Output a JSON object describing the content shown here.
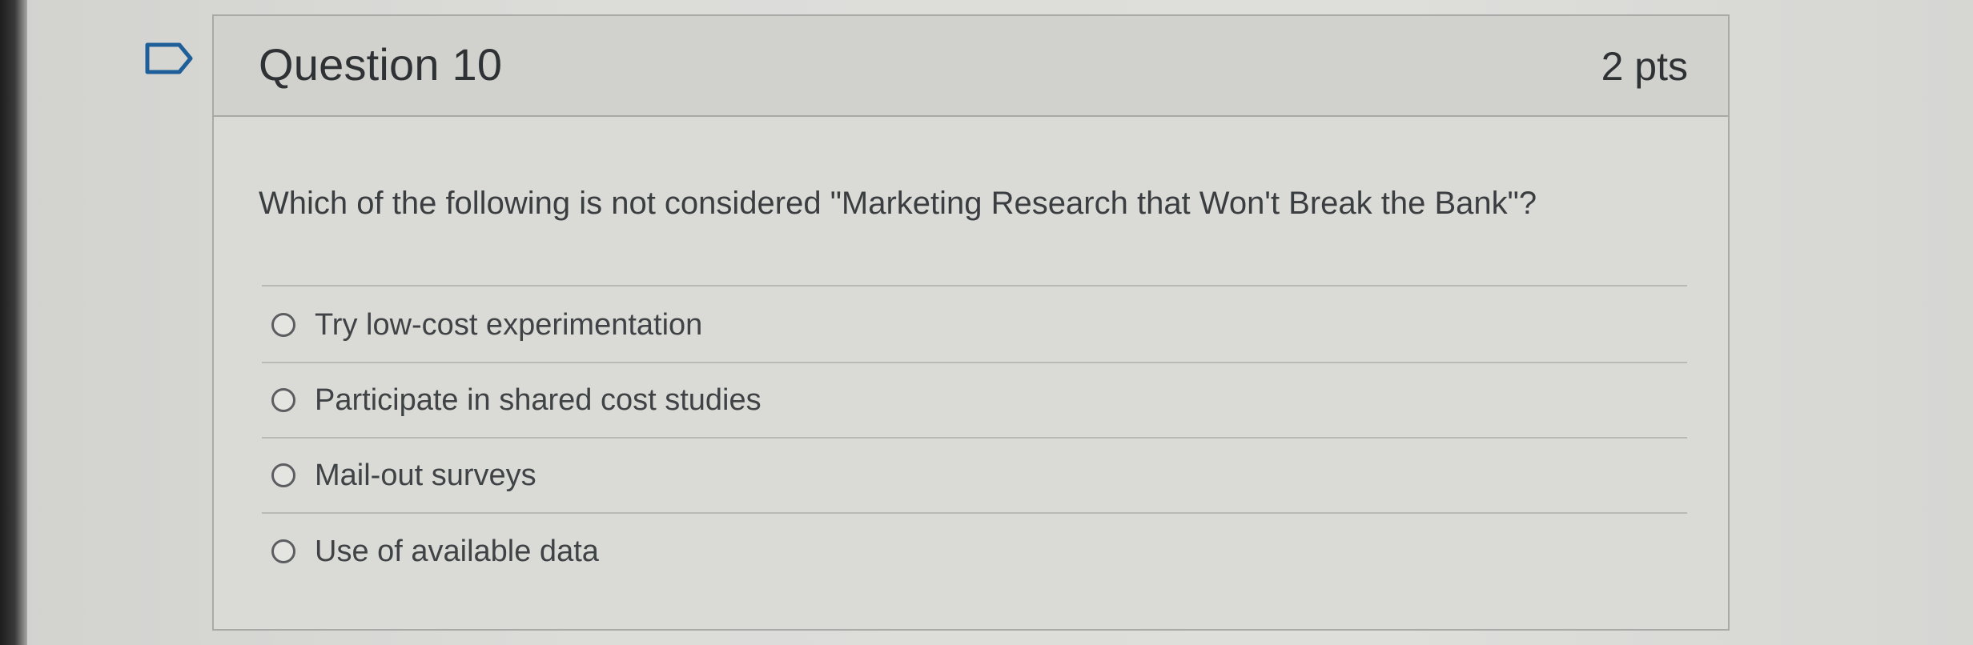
{
  "question": {
    "title": "Question 10",
    "points": "2 pts",
    "text": "Which of the following is not considered \"Marketing Research that Won't Break the Bank\"?",
    "answers": [
      {
        "label": "Try low-cost experimentation"
      },
      {
        "label": "Participate in shared cost studies"
      },
      {
        "label": "Mail-out surveys"
      },
      {
        "label": "Use of available data"
      }
    ]
  },
  "icons": {
    "flag": "flag-bookmark-icon",
    "radio": "radio-unchecked-icon"
  },
  "colors": {
    "background": "#dadad6",
    "header": "#d1d1cd",
    "text": "#3a3d40",
    "border": "#a9aaa7"
  }
}
